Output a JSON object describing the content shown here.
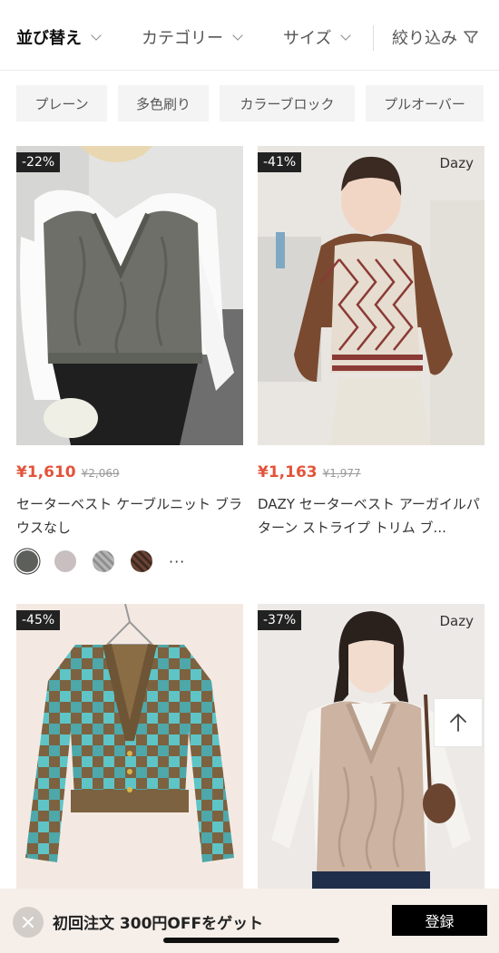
{
  "filter_bar": {
    "sort_label": "並び替え",
    "category_label": "カテゴリー",
    "size_label": "サイズ",
    "filter_label": "絞り込み"
  },
  "chips": [
    "プレーン",
    "多色刷り",
    "カラーブロック",
    "プルオーバー"
  ],
  "products": [
    {
      "discount": "-22%",
      "brand": "",
      "price": "¥1,610",
      "original_price": "¥2,069",
      "title": "セーターベスト ケーブルニット ブラウスなし",
      "swatch_colors": [
        "#5d5f5a",
        "#c9bfc0",
        "#a9a9a9",
        "#5a3b2e"
      ],
      "more": "···"
    },
    {
      "discount": "-41%",
      "brand": "Dazy",
      "price": "¥1,163",
      "original_price": "¥1,977",
      "title": "DAZY セーターベスト アーガイルパターン ストライプ トリム ブ..."
    },
    {
      "discount": "-45%",
      "brand": ""
    },
    {
      "discount": "-37%",
      "brand": "Dazy"
    }
  ],
  "banner": {
    "text": "初回注文 300円OFFをゲット",
    "button_label": "登録"
  },
  "colors": {
    "price_red": "#e2543a",
    "banner_bg": "#f5eee9"
  }
}
